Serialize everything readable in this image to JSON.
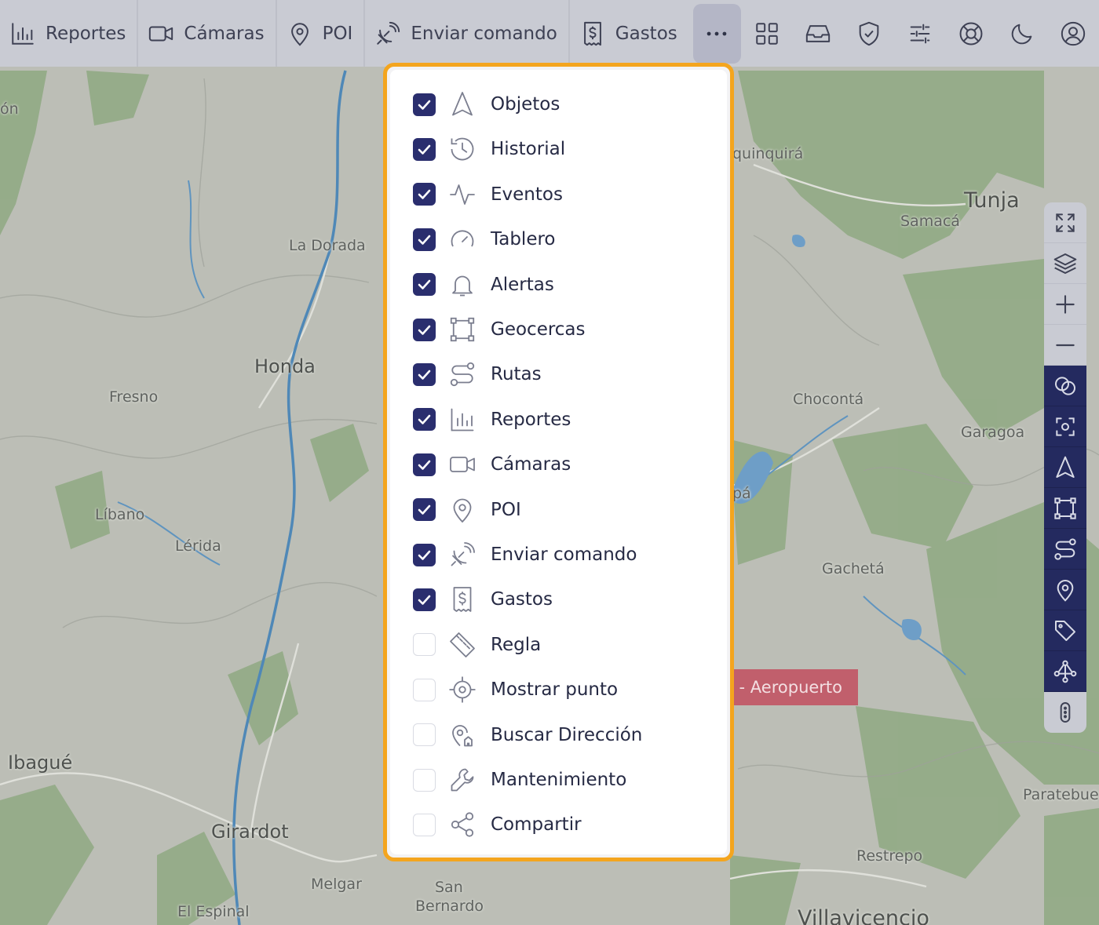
{
  "toolbar": {
    "items": [
      {
        "label": "Reportes",
        "icon": "bar-chart-icon"
      },
      {
        "label": "Cámaras",
        "icon": "video-camera-icon"
      },
      {
        "label": "POI",
        "icon": "map-pin-icon"
      },
      {
        "label": "Enviar comando",
        "icon": "satellite-dish-icon"
      },
      {
        "label": "Gastos",
        "icon": "receipt-dollar-icon"
      }
    ],
    "more_icon": "more-horizontal-icon",
    "right_icons": [
      "grid-icon",
      "inbox-icon",
      "shield-check-icon",
      "sliders-icon",
      "lifebuoy-icon",
      "moon-icon",
      "user-circle-icon"
    ]
  },
  "dropdown": {
    "items": [
      {
        "label": "Objetos",
        "checked": true,
        "icon": "navigation-arrow-icon"
      },
      {
        "label": "Historial",
        "checked": true,
        "icon": "history-icon"
      },
      {
        "label": "Eventos",
        "checked": true,
        "icon": "activity-icon"
      },
      {
        "label": "Tablero",
        "checked": true,
        "icon": "gauge-icon"
      },
      {
        "label": "Alertas",
        "checked": true,
        "icon": "bell-icon"
      },
      {
        "label": "Geocercas",
        "checked": true,
        "icon": "geofence-icon"
      },
      {
        "label": "Rutas",
        "checked": true,
        "icon": "route-icon"
      },
      {
        "label": "Reportes",
        "checked": true,
        "icon": "bar-chart-icon"
      },
      {
        "label": "Cámaras",
        "checked": true,
        "icon": "video-camera-icon"
      },
      {
        "label": "POI",
        "checked": true,
        "icon": "map-pin-icon"
      },
      {
        "label": "Enviar comando",
        "checked": true,
        "icon": "satellite-dish-icon"
      },
      {
        "label": "Gastos",
        "checked": true,
        "icon": "receipt-dollar-icon"
      },
      {
        "label": "Regla",
        "checked": false,
        "icon": "ruler-icon"
      },
      {
        "label": "Mostrar punto",
        "checked": false,
        "icon": "crosshair-icon"
      },
      {
        "label": "Buscar Dirección",
        "checked": false,
        "icon": "search-location-icon"
      },
      {
        "label": "Mantenimiento",
        "checked": false,
        "icon": "wrench-icon"
      },
      {
        "label": "Compartir",
        "checked": false,
        "icon": "share-icon"
      }
    ]
  },
  "map_controls": [
    {
      "icon": "fullscreen-icon",
      "active": false
    },
    {
      "icon": "layers-icon",
      "active": false
    },
    {
      "icon": "zoom-in-icon",
      "active": false
    },
    {
      "icon": "zoom-out-icon",
      "active": false
    },
    {
      "icon": "circles-overlap-icon",
      "active": true
    },
    {
      "icon": "focus-target-icon",
      "active": true
    },
    {
      "icon": "navigation-arrow-icon",
      "active": true
    },
    {
      "icon": "geofence-icon",
      "active": true
    },
    {
      "icon": "route-icon",
      "active": true
    },
    {
      "icon": "map-pin-icon",
      "active": true
    },
    {
      "icon": "tag-icon",
      "active": true
    },
    {
      "icon": "network-icon",
      "active": true
    },
    {
      "icon": "more-vertical-icon",
      "active": false
    }
  ],
  "map": {
    "places": {
      "fresno": "Fresno",
      "libano": "Líbano",
      "lerida": "Lérida",
      "honda": "Honda",
      "la_dorada": "La Dorada",
      "ibague": "Ibagué",
      "girardot": "Girardot",
      "melgar": "Melgar",
      "el_espinal": "El Espinal",
      "san": "San",
      "bernardo": "Bernardo",
      "tunja": "Tunja",
      "samaca": "Samacá",
      "chiquinquira_partial": "quinquirá",
      "choconta": "Chocontá",
      "garagoa": "Garagoa",
      "gacheta": "Gachetá",
      "paratebueno_partial": "Paratebue",
      "restrepo": "Restrepo",
      "villavicencio": "Villavicencio",
      "left_partial": "ón",
      "ubate_partial": "pá"
    },
    "marker_label": "a - Aeropuerto"
  }
}
